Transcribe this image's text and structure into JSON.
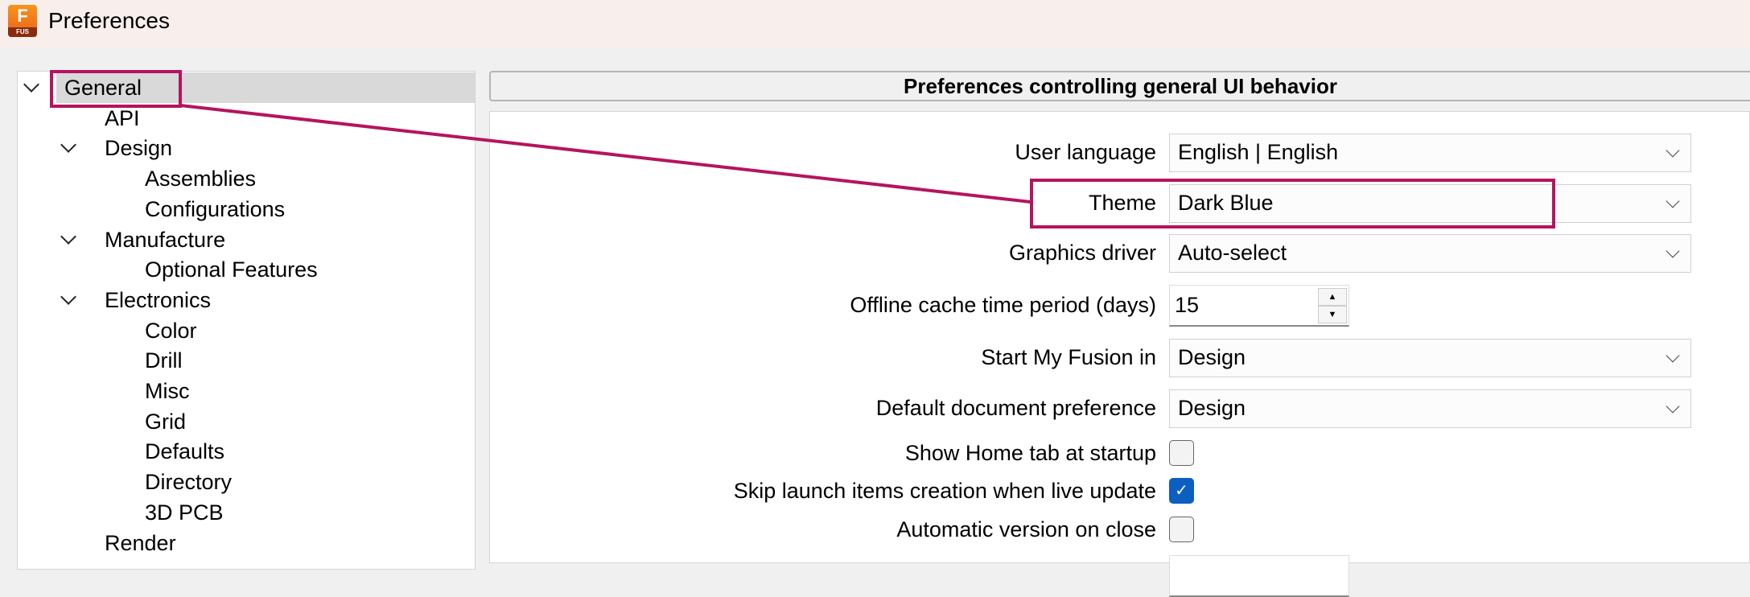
{
  "window": {
    "title": "Preferences",
    "logo_letter": "F",
    "logo_sub": "FUS"
  },
  "tree": [
    {
      "label": "General",
      "level": 0,
      "expanded": true,
      "selected": true
    },
    {
      "label": "API",
      "level": 1
    },
    {
      "label": "Design",
      "level": 1,
      "expanded": true
    },
    {
      "label": "Assemblies",
      "level": 2
    },
    {
      "label": "Configurations",
      "level": 2
    },
    {
      "label": "Manufacture",
      "level": 1,
      "expanded": true
    },
    {
      "label": "Optional Features",
      "level": 2
    },
    {
      "label": "Electronics",
      "level": 1,
      "expanded": true
    },
    {
      "label": "Color",
      "level": 2
    },
    {
      "label": "Drill",
      "level": 2
    },
    {
      "label": "Misc",
      "level": 2
    },
    {
      "label": "Grid",
      "level": 2
    },
    {
      "label": "Defaults",
      "level": 2
    },
    {
      "label": "Directory",
      "level": 2
    },
    {
      "label": "3D PCB",
      "level": 2
    },
    {
      "label": "Render",
      "level": 1
    }
  ],
  "panel": {
    "header": "Preferences controlling general UI behavior",
    "user_language": {
      "label": "User language",
      "value": "English | English"
    },
    "theme": {
      "label": "Theme",
      "value": "Dark Blue"
    },
    "graphics_driver": {
      "label": "Graphics driver",
      "value": "Auto-select"
    },
    "offline_cache": {
      "label": "Offline cache time period (days)",
      "value": "15"
    },
    "start_my_fusion": {
      "label": "Start My Fusion in",
      "value": "Design"
    },
    "default_document": {
      "label": "Default document preference",
      "value": "Design"
    },
    "show_home_tab": {
      "label": "Show Home tab at startup",
      "checked": false
    },
    "skip_launch": {
      "label": "Skip launch items creation when live update",
      "checked": true
    },
    "auto_version": {
      "label": "Automatic version on close",
      "checked": false
    }
  },
  "colors": {
    "annotation": "#b5145f",
    "checkbox_checked": "#0a5fc1"
  }
}
